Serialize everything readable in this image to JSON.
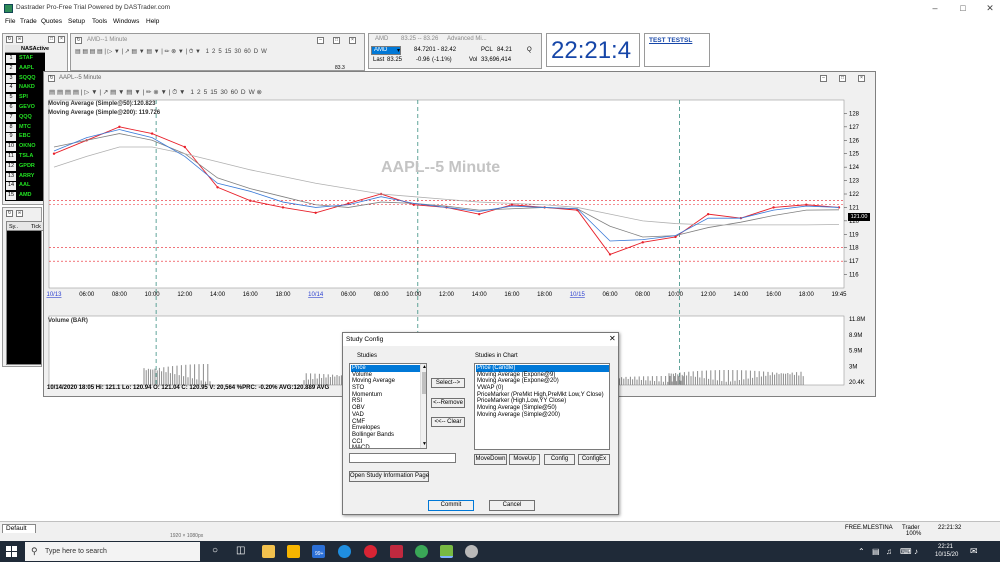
{
  "app": {
    "title": "Dastrader Pro-Free Trial Powered by DASTrader.com",
    "menu": [
      "File",
      "Trade",
      "Quotes",
      "Setup",
      "Tools",
      "Windows",
      "Help"
    ]
  },
  "watchlist": {
    "header": "NASActive",
    "rows": [
      {
        "n": "1",
        "s": "STAF"
      },
      {
        "n": "2",
        "s": "AAPL"
      },
      {
        "n": "3",
        "s": "SQQQ"
      },
      {
        "n": "4",
        "s": "NAKD"
      },
      {
        "n": "5",
        "s": "SPI"
      },
      {
        "n": "6",
        "s": "GEVO"
      },
      {
        "n": "7",
        "s": "QQQ"
      },
      {
        "n": "8",
        "s": "MTC"
      },
      {
        "n": "9",
        "s": "EBC"
      },
      {
        "n": "10",
        "s": "OKNO"
      },
      {
        "n": "11",
        "s": "TSLA"
      },
      {
        "n": "12",
        "s": "GPDR"
      },
      {
        "n": "13",
        "s": "ARRY"
      },
      {
        "n": "14",
        "s": "AAL"
      },
      {
        "n": "15",
        "s": "AMD"
      }
    ]
  },
  "timesales": {
    "col1": "Sy..",
    "col2": "Tick"
  },
  "amd_chart": {
    "title": "AMD--1 Minute",
    "tf": [
      "1",
      "2",
      "5",
      "15",
      "30",
      "60",
      "D",
      "W"
    ],
    "edge_value": "83.3"
  },
  "quote": {
    "title": "AMD",
    "range": "83.25 -- 83.26",
    "exchange": "Advanced Mi...",
    "symbol": "AMD",
    "price": "84.7201 - 82.42",
    "pcl_label": "PCL",
    "pcl": "84.21",
    "q": "Q",
    "last_label": "Last",
    "last": "83.25",
    "change": "-0.96",
    "change_pct": "(-1.1%)",
    "vol_label": "Vol",
    "vol": "33,696,414"
  },
  "clock": {
    "time": "22:21:4"
  },
  "account": {
    "label": "TEST TESTSL"
  },
  "aapl_chart": {
    "title": "AAPL--5 Minute",
    "window_title": "AAPL--5 Minute",
    "tf": [
      "1",
      "2",
      "5",
      "15",
      "30",
      "60",
      "D",
      "W"
    ],
    "study1": "Moving Average (Simple@50):120.823",
    "study2": "Moving Average (Simple@200): 119.726",
    "price_label": "121.00",
    "volume_title": "Volume (BAR)",
    "vol_axis": [
      "11.8M",
      "8.9M",
      "5.9M",
      "3M",
      "20.4K"
    ],
    "status": "10/14/2020 18:05   Hi: 121.1   Lo: 120.94   O: 121.04   C: 120.95   V: 20,564   %PRC: -0.20%   AVG:120.889   AVG"
  },
  "chart_data": {
    "type": "line",
    "title": "AAPL--5 Minute",
    "x": [
      "10/13",
      "06:00",
      "08:00",
      "10:00",
      "12:00",
      "14:00",
      "16:00",
      "18:00",
      "10/14",
      "06:00",
      "08:00",
      "10:00",
      "12:00",
      "14:00",
      "16:00",
      "18:00",
      "10/15",
      "06:00",
      "08:00",
      "10:00",
      "12:00",
      "14:00",
      "16:00",
      "18:00",
      "19:45"
    ],
    "ylim": [
      115,
      129
    ],
    "yticks": [
      116,
      117,
      118,
      119,
      120,
      121,
      122,
      123,
      124,
      125,
      126,
      127,
      128
    ],
    "series": [
      {
        "name": "Price (Candle)",
        "color": "#e8202a",
        "values": [
          125.0,
          126.0,
          127.0,
          126.5,
          125.5,
          122.5,
          121.5,
          121.0,
          120.6,
          121.3,
          122.0,
          121.2,
          121.0,
          120.5,
          121.2,
          121.0,
          120.8,
          117.5,
          118.4,
          118.8,
          120.5,
          120.2,
          121.0,
          121.2,
          121.0
        ]
      },
      {
        "name": "Moving Average (Simple@50)",
        "color": "#808080",
        "values": [
          125.5,
          126.0,
          126.5,
          126.0,
          125.0,
          123.2,
          122.4,
          121.8,
          121.2,
          121.0,
          121.4,
          121.3,
          121.1,
          120.8,
          120.9,
          121.0,
          120.9,
          119.6,
          118.8,
          118.9,
          119.5,
          119.9,
          120.4,
          120.8,
          120.823
        ]
      },
      {
        "name": "Moving Average (Simple@200)",
        "color": "#b0b0b0",
        "values": [
          124.0,
          124.8,
          125.5,
          125.5,
          125.0,
          124.4,
          123.8,
          123.3,
          122.8,
          122.4,
          122.0,
          121.8,
          121.6,
          121.4,
          121.3,
          121.2,
          121.0,
          120.5,
          120.0,
          119.8,
          119.7,
          119.7,
          119.7,
          119.7,
          119.726
        ]
      },
      {
        "name": "Moving Average (Expone@20)",
        "color": "#3b7bd8",
        "values": [
          125.2,
          126.2,
          126.8,
          126.2,
          124.8,
          122.8,
          122.2,
          121.4,
          121.0,
          121.2,
          121.8,
          121.3,
          121.0,
          120.7,
          121.1,
          121.0,
          120.9,
          118.5,
          118.6,
          118.9,
          120.2,
          120.2,
          120.8,
          121.1,
          121.0
        ]
      }
    ],
    "hlines": [
      121.5,
      121.2,
      118.0,
      117.0
    ],
    "vol_ylim": [
      0,
      11.8
    ]
  },
  "dialog": {
    "title": "Study Config",
    "studies_label": "Studies",
    "in_chart_label": "Studies in Chart",
    "studies": [
      "Price",
      "Volume",
      "Moving Average",
      "STO",
      "Momentum",
      "RSI",
      "OBV",
      "VAD",
      "CMF",
      "Envelopes",
      "Bollinger Bands",
      "CCI",
      "MACD"
    ],
    "in_chart": [
      "Price (Candle)",
      "Moving Average (Expone@9)",
      "Moving Average (Expone@20)",
      "VWAP (0)",
      "PriceMarker (PreMkt High,PreMkt Low,Y Close)",
      "PriceMarker (High,Low,YY Close)",
      "Moving Average (Simple@50)",
      "Moving Average (Simple@200)"
    ],
    "select": "Select-->",
    "remove": "<--Remove",
    "clear": "<<-- Clear",
    "movedown": "MoveDown",
    "moveup": "MoveUp",
    "config": "Config",
    "configex": "ConfigEx",
    "info": "Open Study Information Page",
    "commit": "Commit",
    "cancel": "Cancel"
  },
  "statusbar": {
    "tab": "Default",
    "resolution": "1920 × 1080px",
    "user": "FREE.MLESTINA",
    "role": "Trader",
    "time": "22:21:32"
  },
  "taskbar": {
    "search": "Type here to search",
    "zoom": "100%",
    "clock_time": "22:21",
    "clock_date": "10/15/20",
    "badge": "99+"
  }
}
